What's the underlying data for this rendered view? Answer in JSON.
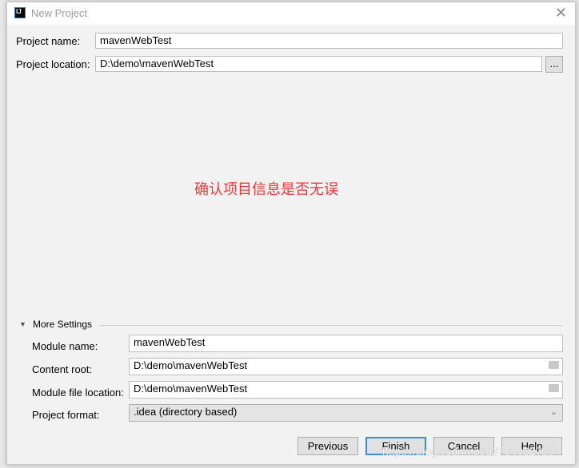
{
  "window": {
    "title": "New Project",
    "logo": "IJ"
  },
  "project_name": {
    "label": "Project name:",
    "value": "mavenWebTest"
  },
  "project_location": {
    "label": "Project location:",
    "value": "D:\\demo\\mavenWebTest",
    "browse": "..."
  },
  "annotation": "确认项目信息是否无误",
  "more_settings": {
    "label": "More Settings",
    "module_name": {
      "label": "Module name:",
      "value": "mavenWebTest"
    },
    "content_root": {
      "label": "Content root:",
      "value": "D:\\demo\\mavenWebTest"
    },
    "module_file_location": {
      "label": "Module file location:",
      "value": "D:\\demo\\mavenWebTest"
    },
    "project_format": {
      "label": "Project format:",
      "value": ".idea (directory based)"
    }
  },
  "buttons": {
    "previous": "Previous",
    "finish": "Finish",
    "cancel": "Cancel",
    "help": "Help"
  },
  "watermark": "https://blog.csdn.net/u2764032703",
  "colors": {
    "annotation": "#e8393a",
    "focus": "#3c8ee0"
  }
}
